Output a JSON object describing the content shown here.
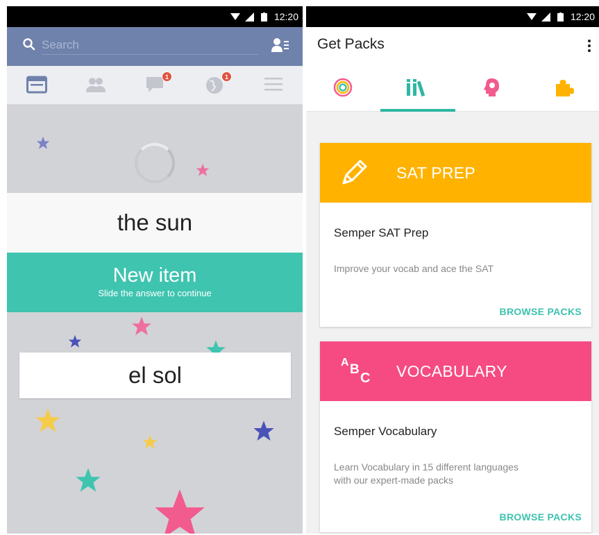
{
  "left_screen": {
    "status_time": "12:20",
    "search": {
      "placeholder": "Search"
    },
    "tabs": [
      {
        "name": "news-feed",
        "icon": "newspaper-icon",
        "badge": ""
      },
      {
        "name": "friends",
        "icon": "people-icon",
        "badge": ""
      },
      {
        "name": "messages",
        "icon": "chat-icon",
        "badge": "1"
      },
      {
        "name": "notifications",
        "icon": "globe-icon",
        "badge": "1"
      },
      {
        "name": "more",
        "icon": "menu-icon",
        "badge": ""
      }
    ],
    "question_text": "the sun",
    "banner": {
      "title": "New item",
      "subtitle": "Slide the answer to continue",
      "color": "#3fc4b0"
    },
    "answer_text": "el sol",
    "star_colors": [
      "#7b83c6",
      "#ee6fa0",
      "#3fc4b0",
      "#f6cb4a",
      "#4a52b8",
      "#f25b8e"
    ]
  },
  "right_screen": {
    "status_time": "12:20",
    "title": "Get Packs",
    "tabs": [
      {
        "name": "target",
        "icon": "target-icon",
        "selected": false
      },
      {
        "name": "library",
        "icon": "books-icon",
        "selected": true
      },
      {
        "name": "mind",
        "icon": "head-icon",
        "selected": false
      },
      {
        "name": "puzzle",
        "icon": "puzzle-icon",
        "selected": false
      }
    ],
    "packs": [
      {
        "header": "SAT PREP",
        "header_color": "#ffb300",
        "icon": "pencil-icon",
        "name": "Semper SAT Prep",
        "description": "Improve your vocab and ace the SAT",
        "action": "BROWSE PACKS"
      },
      {
        "header": "VOCABULARY",
        "header_color": "#f64b82",
        "icon": "abc-icon",
        "icon_text": "ABC",
        "name": "Semper Vocabulary",
        "description": "Learn Vocabulary in 15 different languages\nwith our expert-made packs",
        "action": "BROWSE PACKS"
      }
    ],
    "accent_color": "#2fb7a3"
  }
}
